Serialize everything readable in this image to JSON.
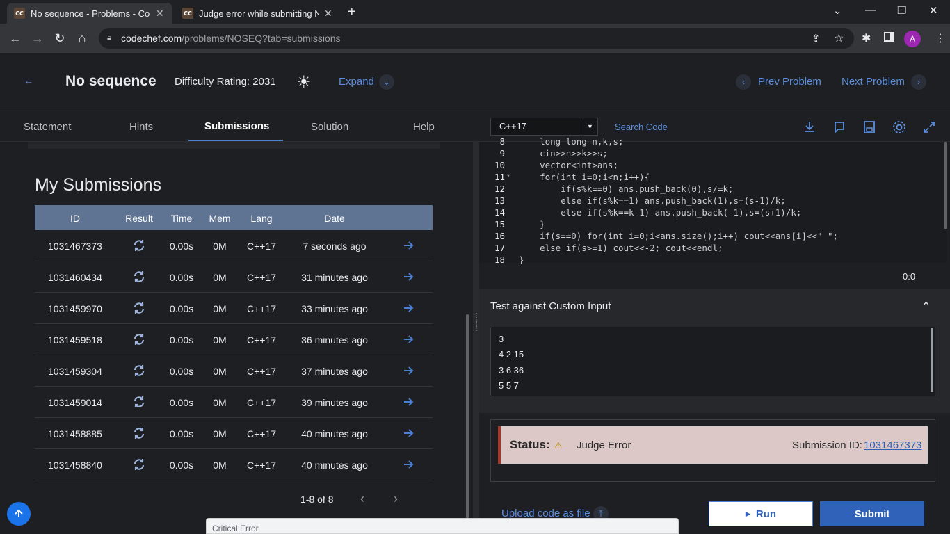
{
  "browser": {
    "tabs": [
      {
        "favicon": "CC",
        "title": "No sequence - Problems - Code"
      },
      {
        "favicon": "CC",
        "title": "Judge error while submitting NC"
      }
    ],
    "url_host": "codechef.com",
    "url_path": "/problems/NOSEQ?tab=submissions",
    "profile_initial": "A"
  },
  "header": {
    "title": "No sequence",
    "difficulty": "Difficulty Rating: 2031",
    "expand": "Expand",
    "prev": "Prev Problem",
    "next": "Next Problem"
  },
  "tabs": [
    "Statement",
    "Hints",
    "Submissions",
    "Solution",
    "Help"
  ],
  "submissions": {
    "heading": "My Submissions",
    "columns": [
      "ID",
      "Result",
      "Time",
      "Mem",
      "Lang",
      "Date"
    ],
    "rows": [
      {
        "id": "1031467373",
        "time": "0.00s",
        "mem": "0M",
        "lang": "C++17",
        "date": "7 seconds ago"
      },
      {
        "id": "1031460434",
        "time": "0.00s",
        "mem": "0M",
        "lang": "C++17",
        "date": "31 minutes ago"
      },
      {
        "id": "1031459970",
        "time": "0.00s",
        "mem": "0M",
        "lang": "C++17",
        "date": "33 minutes ago"
      },
      {
        "id": "1031459518",
        "time": "0.00s",
        "mem": "0M",
        "lang": "C++17",
        "date": "36 minutes ago"
      },
      {
        "id": "1031459304",
        "time": "0.00s",
        "mem": "0M",
        "lang": "C++17",
        "date": "37 minutes ago"
      },
      {
        "id": "1031459014",
        "time": "0.00s",
        "mem": "0M",
        "lang": "C++17",
        "date": "39 minutes ago"
      },
      {
        "id": "1031458885",
        "time": "0.00s",
        "mem": "0M",
        "lang": "C++17",
        "date": "40 minutes ago"
      },
      {
        "id": "1031458840",
        "time": "0.00s",
        "mem": "0M",
        "lang": "C++17",
        "date": "40 minutes ago"
      }
    ],
    "pager": "1-8 of 8"
  },
  "editor": {
    "language": "C++17",
    "search": "Search Code",
    "lines": [
      {
        "n": "8",
        "code": "    long long n,k,s;"
      },
      {
        "n": "9",
        "code": "    cin>>n>>k>>s;"
      },
      {
        "n": "10",
        "code": "    vector<int>ans;"
      },
      {
        "n": "11",
        "code": "    for(int i=0;i<n;i++){"
      },
      {
        "n": "12",
        "code": "        if(s%k==0) ans.push_back(0),s/=k;"
      },
      {
        "n": "13",
        "code": "        else if(s%k==1) ans.push_back(1),s=(s-1)/k;"
      },
      {
        "n": "14",
        "code": "        else if(s%k==k-1) ans.push_back(-1),s=(s+1)/k;"
      },
      {
        "n": "15",
        "code": "    }"
      },
      {
        "n": "16",
        "code": "    if(s==0) for(int i=0;i<ans.size();i++) cout<<ans[i]<<\" \";"
      },
      {
        "n": "17",
        "code": "    else if(s>=1) cout<<-2; cout<<endl;"
      },
      {
        "n": "18",
        "code": "}"
      }
    ],
    "cursor": "0:0"
  },
  "custom_input": {
    "title": "Test against Custom Input",
    "lines": [
      "3",
      "4 2 15",
      "3 6 36",
      "5 5 7"
    ]
  },
  "status": {
    "label": "Status:",
    "value": "Judge Error",
    "submission_label": "Submission ID:",
    "submission_id": "1031467373"
  },
  "actions": {
    "upload": "Upload code as file",
    "run": "Run",
    "submit": "Submit"
  },
  "toast": "Critical Error",
  "colors": {
    "accent": "#2f62b8",
    "link": "#5b8ede",
    "table_header": "#5f7393",
    "status_bg": "#dcc9c7",
    "status_border": "#a4372b"
  }
}
